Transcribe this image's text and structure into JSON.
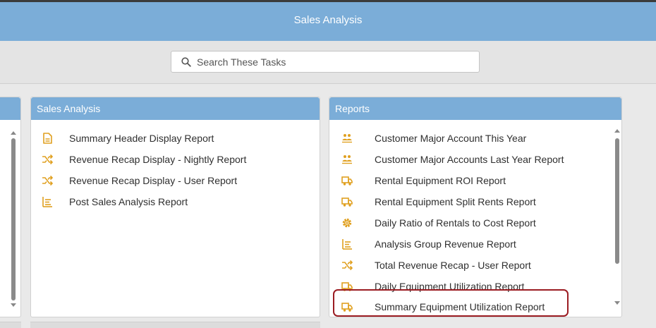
{
  "header": {
    "title": "Sales Analysis"
  },
  "search": {
    "placeholder": "Search These Tasks"
  },
  "panels": {
    "sales": {
      "title": "Sales Analysis",
      "items": [
        {
          "label": "Summary Header Display Report",
          "icon": "document-icon"
        },
        {
          "label": "Revenue Recap Display - Nightly Report",
          "icon": "shuffle-icon"
        },
        {
          "label": "Revenue Recap Display - User Report",
          "icon": "shuffle-icon"
        },
        {
          "label": "Post Sales Analysis Report",
          "icon": "list-icon"
        }
      ]
    },
    "reports": {
      "title": "Reports",
      "items": [
        {
          "label": "Customer Major Account This Year",
          "icon": "people-icon"
        },
        {
          "label": "Customer Major Accounts Last Year Report",
          "icon": "people-icon"
        },
        {
          "label": "Rental Equipment ROI Report",
          "icon": "truck-icon"
        },
        {
          "label": "Rental Equipment Split Rents Report",
          "icon": "truck-icon"
        },
        {
          "label": "Daily Ratio of Rentals to Cost Report",
          "icon": "gear-icon"
        },
        {
          "label": "Analysis Group Revenue Report",
          "icon": "list-icon"
        },
        {
          "label": "Total Revenue Recap - User Report",
          "icon": "shuffle-icon"
        },
        {
          "label": "Daily Equipment Utilization Report",
          "icon": "truck-icon"
        },
        {
          "label": "Summary Equipment Utilization Report",
          "icon": "truck-icon"
        }
      ]
    }
  },
  "colors": {
    "header": "#7badd8",
    "icon": "#e0a020",
    "highlight": "#9b1c22"
  }
}
